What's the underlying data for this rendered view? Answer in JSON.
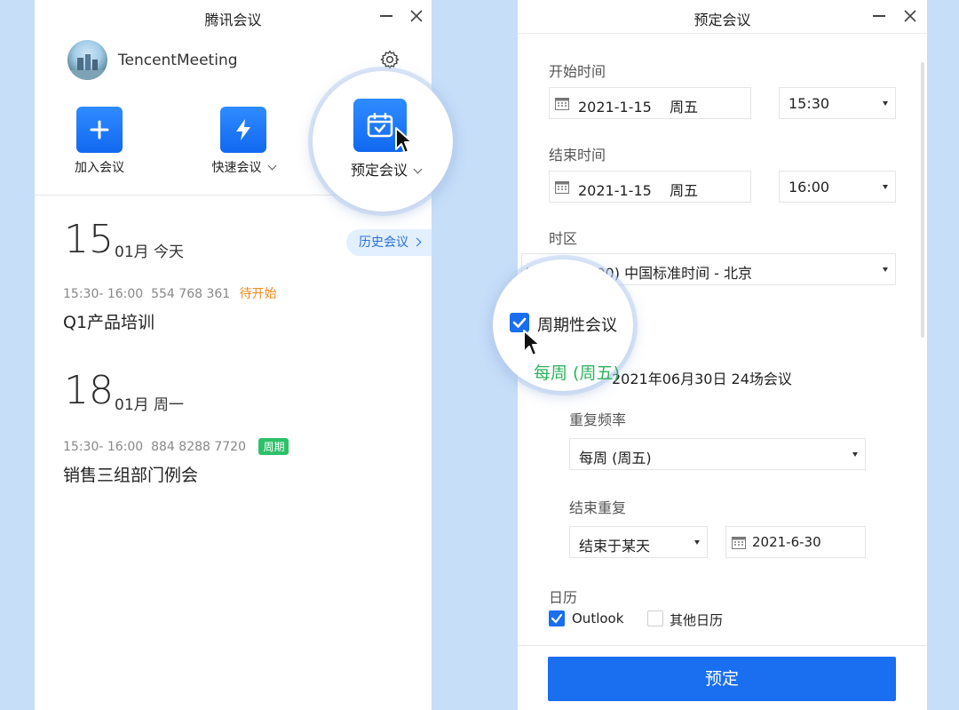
{
  "left_window": {
    "title": "腾讯会议",
    "username": "TencentMeeting",
    "actions": {
      "join": "加入会议",
      "quick": "快速会议",
      "schedule": "预定会议"
    },
    "history_button": "历史会议",
    "days": [
      {
        "day": "15",
        "month": "01月",
        "weekday": "今天",
        "meetings": [
          {
            "time": "15:30- 16:00",
            "id": "554 768 361",
            "status": "待开始",
            "title": "Q1产品培训"
          }
        ]
      },
      {
        "day": "18",
        "month": "01月",
        "weekday": "周一",
        "meetings": [
          {
            "time": "15:30- 16:00",
            "id": "884 8288 7720",
            "badge": "周期",
            "title": "销售三组部门例会"
          }
        ]
      }
    ]
  },
  "right_window": {
    "title": "预定会议",
    "start": {
      "label": "开始时间",
      "date": "2021-1-15",
      "weekday": "周五",
      "time": "15:30"
    },
    "end": {
      "label": "结束时间",
      "date": "2021-1-15",
      "weekday": "周五",
      "time": "16:00"
    },
    "timezone": {
      "label": "时区",
      "value": "(GMT+08:00) 中国标准时间 - 北京"
    },
    "recurring": {
      "checkbox_label": "周期性会议",
      "summary_prefix": "每周 (周五)",
      "summary_suffix": "2021年06月30日 24场会议",
      "frequency_label": "重复频率",
      "frequency_value": "每周 (周五)",
      "end_repeat_label": "结束重复",
      "end_repeat_value": "结束于某天",
      "end_date": "2021-6-30"
    },
    "calendar": {
      "label": "日历",
      "options": [
        {
          "label": "Outlook",
          "checked": true
        },
        {
          "label": "其他日历",
          "checked": false
        }
      ]
    },
    "submit": "预定"
  },
  "colors": {
    "background": "#c6def8",
    "accent": "#1a6ef0",
    "pending": "#f08a1c",
    "periodic": "#2ec06a"
  }
}
